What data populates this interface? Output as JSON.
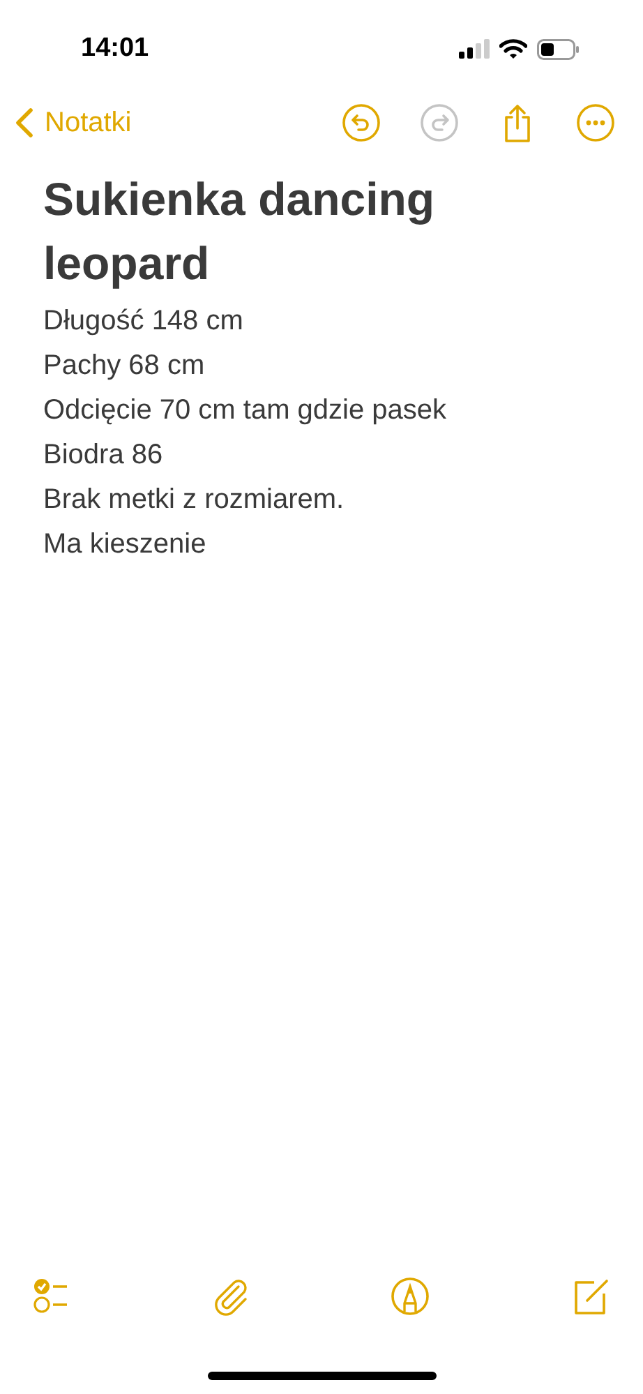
{
  "status_bar": {
    "time": "14:01"
  },
  "nav": {
    "back_label": "Notatki",
    "actions": [
      {
        "kind": "undo",
        "disabled": false
      },
      {
        "kind": "redo",
        "disabled": true
      },
      {
        "kind": "share",
        "disabled": false
      },
      {
        "kind": "more",
        "disabled": false
      }
    ]
  },
  "note": {
    "title": "Sukienka dancing leopard",
    "lines": [
      "Długość 148 cm",
      "Pachy 68 cm",
      "Odcięcie 70 cm tam gdzie pasek",
      "Biodra 86",
      "Brak metki z rozmiarem.",
      "Ma kieszenie"
    ]
  },
  "toolbar": [
    {
      "kind": "checklist"
    },
    {
      "kind": "attach"
    },
    {
      "kind": "markup"
    },
    {
      "kind": "compose"
    }
  ]
}
